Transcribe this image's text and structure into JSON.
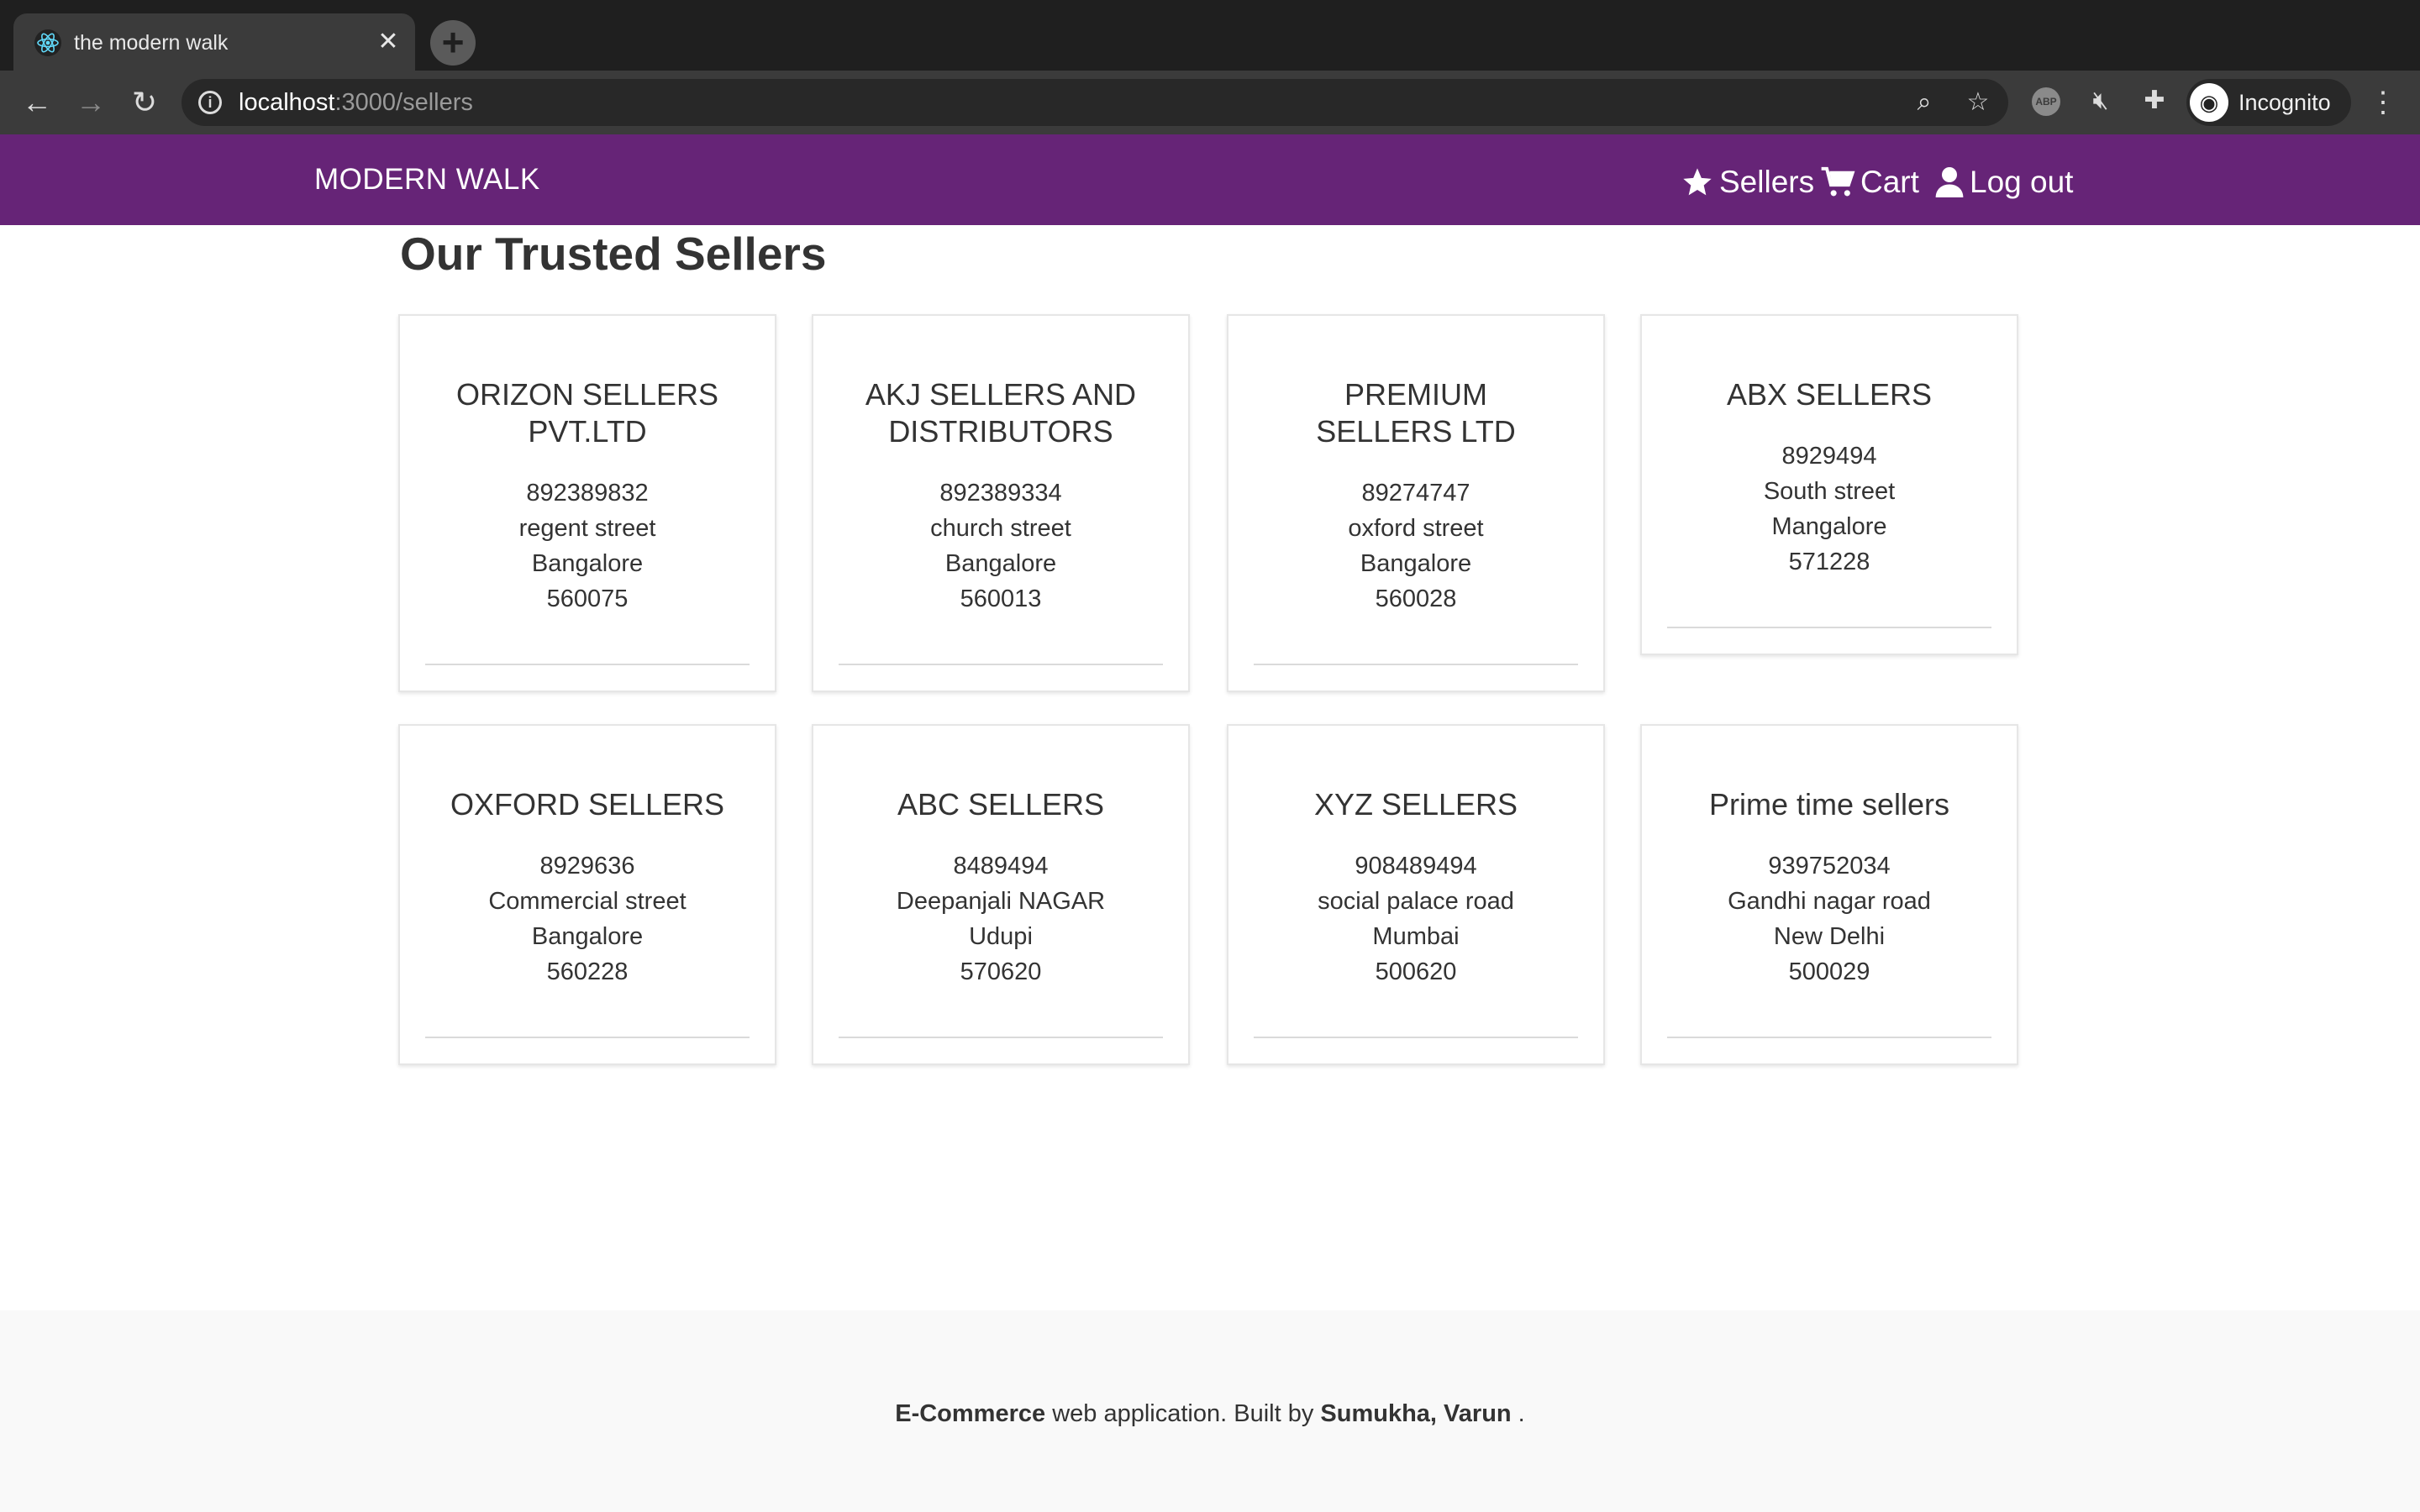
{
  "browser": {
    "tab_title": "the modern walk",
    "url_host": "localhost",
    "url_path": ":3000/sellers",
    "profile_label": "Incognito",
    "extension_abp": "ABP"
  },
  "app": {
    "brand": "MODERN WALK",
    "nav": {
      "sellers": "Sellers",
      "cart": "Cart",
      "logout": "Log out"
    },
    "accent_color": "#662477"
  },
  "page": {
    "title": "Our Trusted Sellers"
  },
  "sellers": [
    {
      "name": "ORIZON SELLERS PVT.LTD",
      "phone": "892389832",
      "street": "regent street",
      "city": "Bangalore",
      "pincode": "560075"
    },
    {
      "name": "AKJ SELLERS AND DISTRIBUTORS",
      "phone": "892389334",
      "street": "church street",
      "city": "Bangalore",
      "pincode": "560013"
    },
    {
      "name": "PREMIUM SELLERS LTD",
      "phone": "89274747",
      "street": "oxford street",
      "city": "Bangalore",
      "pincode": "560028"
    },
    {
      "name": "ABX SELLERS",
      "phone": "8929494",
      "street": "South street",
      "city": "Mangalore",
      "pincode": "571228"
    },
    {
      "name": "OXFORD SELLERS",
      "phone": "8929636",
      "street": "Commercial street",
      "city": "Bangalore",
      "pincode": "560228"
    },
    {
      "name": "ABC SELLERS",
      "phone": "8489494",
      "street": "Deepanjali NAGAR",
      "city": "Udupi",
      "pincode": "570620"
    },
    {
      "name": "XYZ SELLERS",
      "phone": "908489494",
      "street": "social palace road",
      "city": "Mumbai",
      "pincode": "500620"
    },
    {
      "name": "Prime time sellers",
      "phone": "939752034",
      "street": "Gandhi nagar road",
      "city": "New Delhi",
      "pincode": "500029"
    }
  ],
  "footer": {
    "bold1": "E-Commerce",
    "text1": " web application. Built by ",
    "bold2": "Sumukha, Varun",
    "text2": " ."
  }
}
